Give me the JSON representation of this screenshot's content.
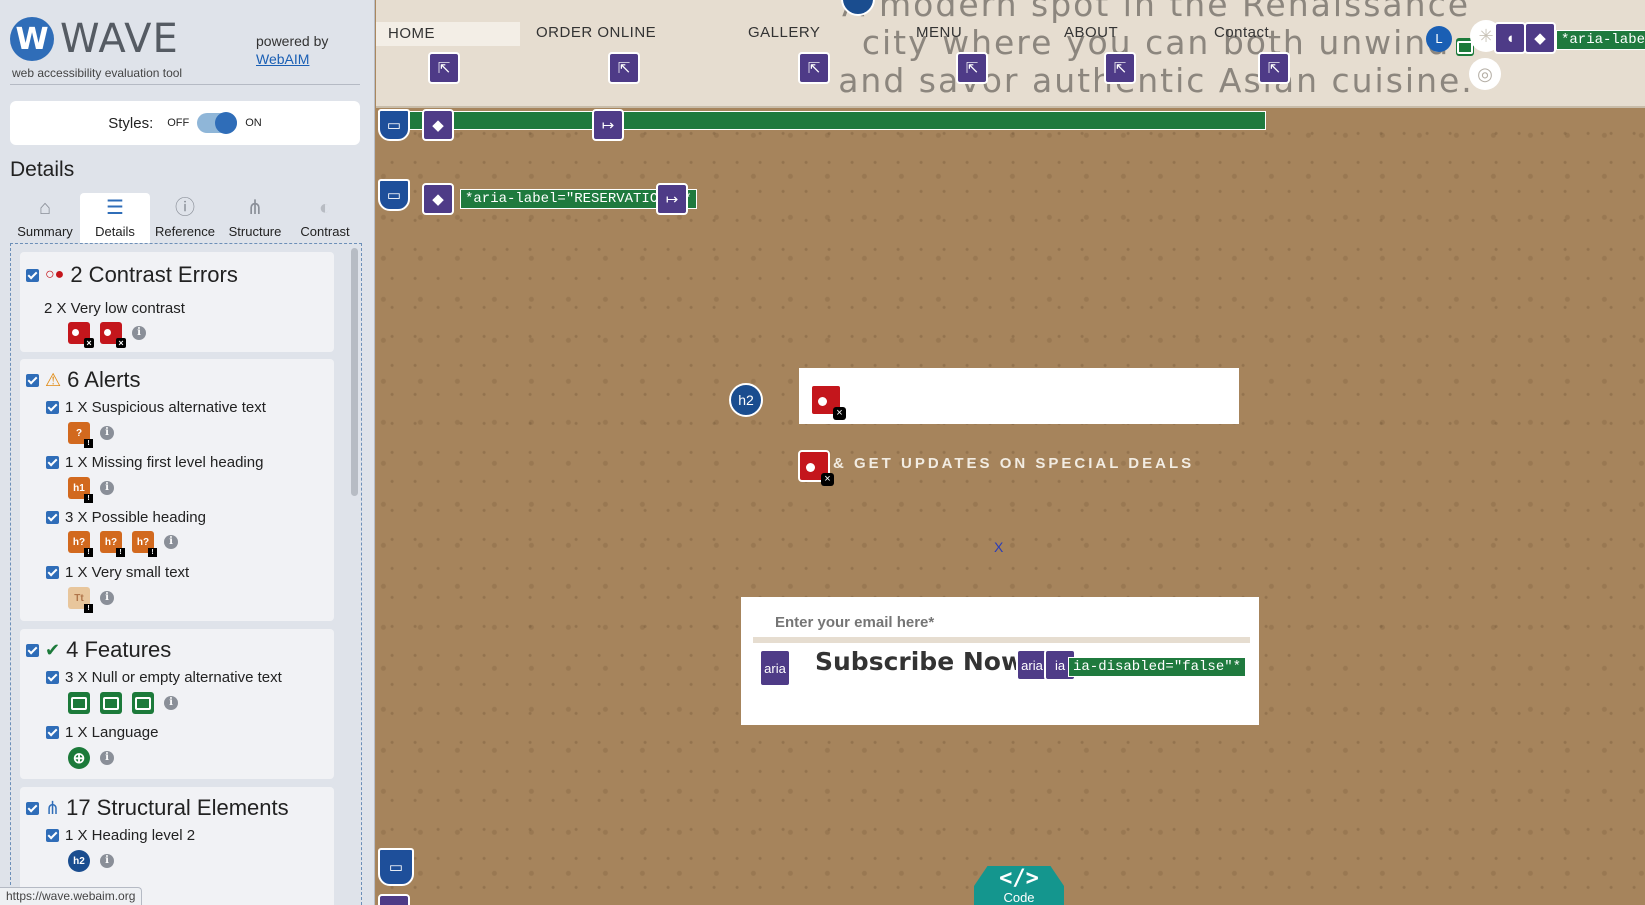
{
  "wave": {
    "logo_letter": "W",
    "logo_word": "WAVE",
    "subtitle": "web accessibility evaluation tool",
    "powered_by": "powered by",
    "powered_link": "WebAIM",
    "styles_label": "Styles:",
    "styles_off": "OFF",
    "styles_on": "ON",
    "details_title": "Details",
    "tabs": [
      {
        "label": "Summary",
        "icon": "home-icon",
        "glyph": "⌂"
      },
      {
        "label": "Details",
        "icon": "list-icon",
        "glyph": "☰"
      },
      {
        "label": "Reference",
        "icon": "info-icon",
        "glyph": "ⓘ"
      },
      {
        "label": "Structure",
        "icon": "hierarchy-icon",
        "glyph": "⋔"
      },
      {
        "label": "Contrast",
        "icon": "contrast-icon",
        "glyph": "◐"
      }
    ],
    "categories": {
      "contrast": {
        "title": "2 Contrast Errors",
        "items": [
          {
            "label": "2 X Very low contrast"
          }
        ]
      },
      "alerts": {
        "title": "6 Alerts",
        "items": [
          {
            "label": "1 X Suspicious alternative text"
          },
          {
            "label": "1 X Missing first level heading"
          },
          {
            "label": "3 X Possible heading"
          },
          {
            "label": "1 X Very small text"
          }
        ]
      },
      "features": {
        "title": "4 Features",
        "items": [
          {
            "label": "3 X Null or empty alternative text"
          },
          {
            "label": "1 X Language"
          }
        ]
      },
      "structure": {
        "title": "17 Structural Elements",
        "items": [
          {
            "label": "1 X Heading level 2"
          }
        ]
      }
    },
    "status_url": "https://wave.webaim.org",
    "colors": {
      "accent": "#2f6db8",
      "error": "#c4161c",
      "alert": "#d2691e",
      "feature": "#1c7a3a",
      "aria": "#4e3b87"
    }
  },
  "site": {
    "hero_text": "A modern spot in the Renaissance city where you can both unwind and savor authentic Asian cuisine.",
    "nav": [
      "HOME",
      "ORDER ONLINE",
      "GALLERY",
      "MENU",
      "ABOUT",
      "Contact"
    ],
    "language_badge": "L",
    "aria_label_top": "*aria-label=\"Li",
    "aria_label_reservations": "*aria-label=\"RESERVATIONS\"*",
    "heading_badge": "h2",
    "updates_text": "& GET UPDATES ON SPECIAL DEALS",
    "close_x": "X",
    "email_placeholder": "Enter your email here*",
    "subscribe_label": "Subscribe Now",
    "aria_badge": "aria",
    "aria_disabled": "ia-disabled=\"false\"*",
    "code_glyph": "</>",
    "code_label": "Code"
  }
}
